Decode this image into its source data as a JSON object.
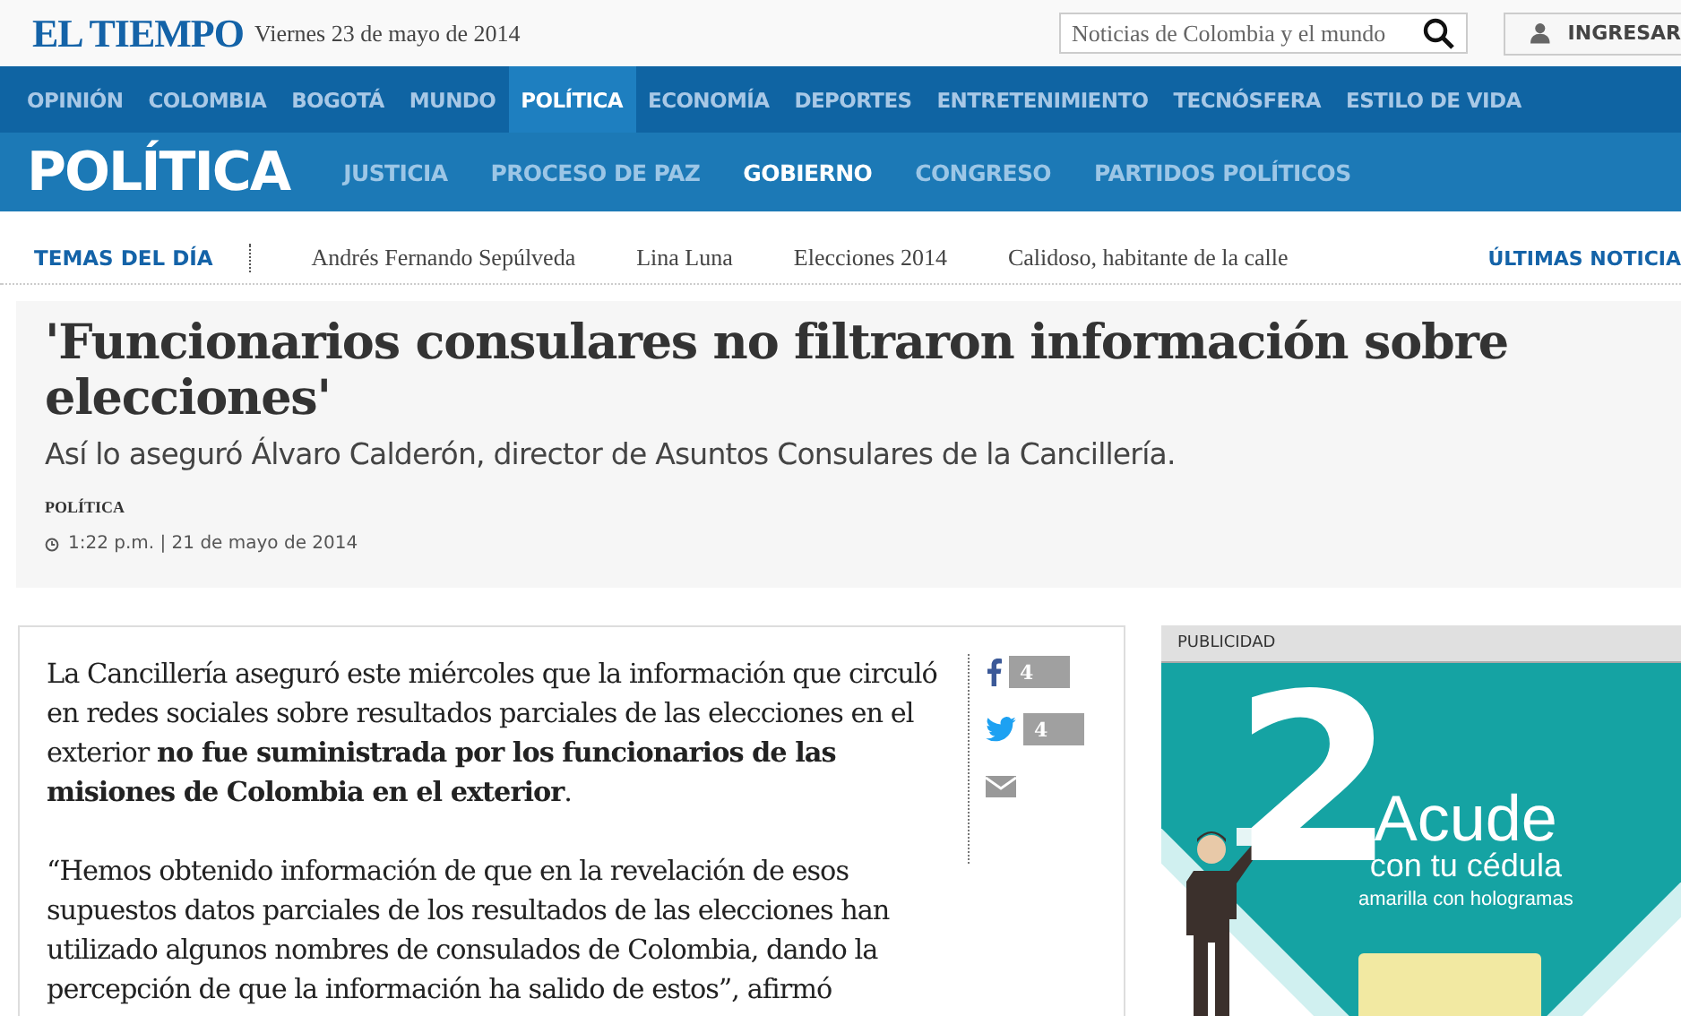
{
  "header": {
    "logo": "EL TIEMPO",
    "date": "Viernes 23 de mayo de 2014",
    "search": {
      "placeholder": "Noticias de Colombia y el mundo"
    },
    "login": "INGRESAR"
  },
  "nav": [
    {
      "label": "OPINIÓN",
      "selected": false
    },
    {
      "label": "COLOMBIA",
      "selected": false
    },
    {
      "label": "BOGOTÁ",
      "selected": false
    },
    {
      "label": "MUNDO",
      "selected": false
    },
    {
      "label": "POLÍTICA",
      "selected": true
    },
    {
      "label": "ECONOMÍA",
      "selected": false
    },
    {
      "label": "DEPORTES",
      "selected": false
    },
    {
      "label": "ENTRETENIMIENTO",
      "selected": false
    },
    {
      "label": "TECNÓSFERA",
      "selected": false
    },
    {
      "label": "ESTILO DE VIDA",
      "selected": false
    }
  ],
  "section": {
    "title": "POLÍTICA",
    "subnav": [
      {
        "label": "JUSTICIA",
        "selected": false
      },
      {
        "label": "PROCESO DE PAZ",
        "selected": false
      },
      {
        "label": "GOBIERNO",
        "selected": true
      },
      {
        "label": "CONGRESO",
        "selected": false
      },
      {
        "label": "PARTIDOS POLÍTICOS",
        "selected": false
      }
    ]
  },
  "topics": {
    "label": "TEMAS DEL DÍA",
    "items": [
      "Andrés Fernando Sepúlveda",
      "Lina Luna",
      "Elecciones 2014",
      "Calidoso, habitante de la calle"
    ],
    "latest": "ÚLTIMAS NOTICIA"
  },
  "article": {
    "title": "'Funcionarios consulares no filtraron información sobre elecciones'",
    "subtitle": "Así lo aseguró Álvaro Calderón, director de Asuntos Consulares de la Cancillería.",
    "section": "POLÍTICA",
    "time": "1:22 p.m. | 21 de mayo de 2014",
    "paragraphs": [
      "La Cancillería aseguró este miércoles que la información que circuló en redes sociales sobre resultados parciales de las elecciones en el exterior **no fue suministrada por los funcionarios de las misiones de Colombia en el exterior**.",
      "“Hemos obtenido información de que en la revelación de esos supuestos datos parciales de los resultados de las elecciones han utilizado algunos nombres de consulados de Colombia, dando la percepción de que la información ha salido de estos”, afirmó"
    ],
    "share": [
      {
        "kind": "facebook",
        "count": "4"
      },
      {
        "kind": "twitter",
        "count": "4"
      },
      {
        "kind": "email"
      }
    ]
  },
  "ad": {
    "label": "PUBLICIDAD",
    "number": "2",
    "headline": "Acude",
    "line_1": "con tu cédula",
    "line_2": "amarilla con hologramas"
  }
}
